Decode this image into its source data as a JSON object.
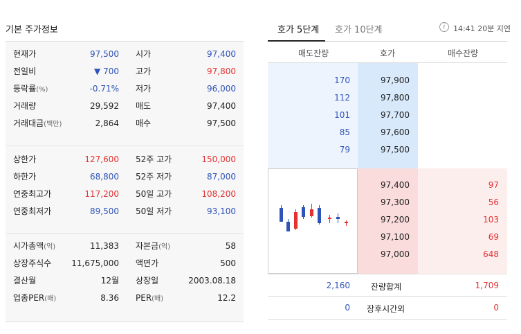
{
  "left": {
    "title": "기본 주가정보",
    "sections": [
      {
        "rows": [
          {
            "l1": "현재가",
            "l1s": "",
            "v1": "97,500",
            "c1": "blue",
            "l2": "시가",
            "l2s": "",
            "v2": "97,400",
            "c2": "blue"
          },
          {
            "l1": "전일비",
            "l1s": "",
            "v1": "▼ 700",
            "c1": "blue",
            "l2": "고가",
            "l2s": "",
            "v2": "97,800",
            "c2": "red"
          },
          {
            "l1": "등락률",
            "l1s": "(%)",
            "v1": "-0.71%",
            "c1": "blue",
            "l2": "저가",
            "l2s": "",
            "v2": "96,000",
            "c2": "blue"
          },
          {
            "l1": "거래량",
            "l1s": "",
            "v1": "29,592",
            "c1": "dark",
            "l2": "매도",
            "l2s": "",
            "v2": "97,400",
            "c2": "dark"
          },
          {
            "l1": "거래대금",
            "l1s": "(백만)",
            "v1": "2,864",
            "c1": "dark",
            "l2": "매수",
            "l2s": "",
            "v2": "97,500",
            "c2": "dark"
          }
        ]
      },
      {
        "rows": [
          {
            "l1": "상한가",
            "l1s": "",
            "v1": "127,600",
            "c1": "red",
            "l2": "52주 고가",
            "l2s": "",
            "v2": "150,000",
            "c2": "red"
          },
          {
            "l1": "하한가",
            "l1s": "",
            "v1": "68,800",
            "c1": "blue",
            "l2": "52주 저가",
            "l2s": "",
            "v2": "87,000",
            "c2": "blue"
          },
          {
            "l1": "연중최고가",
            "l1s": "",
            "v1": "117,200",
            "c1": "red",
            "l2": "50일 고가",
            "l2s": "",
            "v2": "108,200",
            "c2": "red"
          },
          {
            "l1": "연중최저가",
            "l1s": "",
            "v1": "89,500",
            "c1": "blue",
            "l2": "50일 저가",
            "l2s": "",
            "v2": "93,100",
            "c2": "blue"
          }
        ]
      },
      {
        "rows": [
          {
            "l1": "시가총액",
            "l1s": "(억)",
            "v1": "11,383",
            "c1": "dark",
            "l2": "자본금",
            "l2s": "(억)",
            "v2": "58",
            "c2": "dark"
          },
          {
            "l1": "상장주식수",
            "l1s": "",
            "v1": "11,675,000",
            "c1": "dark",
            "l2": "액면가",
            "l2s": "",
            "v2": "500",
            "c2": "dark"
          },
          {
            "l1": "결산월",
            "l1s": "",
            "v1": "12월",
            "c1": "dark",
            "l2": "상장일",
            "l2s": "",
            "v2": "2003.08.18",
            "c2": "dark"
          },
          {
            "l1": "업종PER",
            "l1s": "(배)",
            "v1": "8.36",
            "c1": "dark",
            "l2": "PER",
            "l2s": "(배)",
            "v2": "12.2",
            "c2": "dark"
          }
        ]
      }
    ]
  },
  "right": {
    "tabs": [
      "호가 5단계",
      "호가 10단계"
    ],
    "info_icon": "info-icon",
    "timestamp": "14:41 20분 지연",
    "header": {
      "ask_qty": "매도잔량",
      "price": "호가",
      "bid_qty": "매수잔량"
    },
    "asks": [
      {
        "qty": "170",
        "price": "97,900"
      },
      {
        "qty": "112",
        "price": "97,800"
      },
      {
        "qty": "101",
        "price": "97,700"
      },
      {
        "qty": "85",
        "price": "97,600"
      },
      {
        "qty": "79",
        "price": "97,500"
      }
    ],
    "bids": [
      {
        "price": "97,400",
        "qty": "97"
      },
      {
        "price": "97,300",
        "qty": "56"
      },
      {
        "price": "97,200",
        "qty": "103"
      },
      {
        "price": "97,100",
        "qty": "69"
      },
      {
        "price": "97,000",
        "qty": "648"
      }
    ],
    "summary": {
      "ask_total": "2,160",
      "label": "잔량합계",
      "bid_total": "1,709"
    },
    "after_hours": {
      "ask": "0",
      "label": "장후시간외",
      "bid": "0"
    },
    "colors": {
      "up": "#e33030",
      "down": "#2f53b8"
    }
  }
}
